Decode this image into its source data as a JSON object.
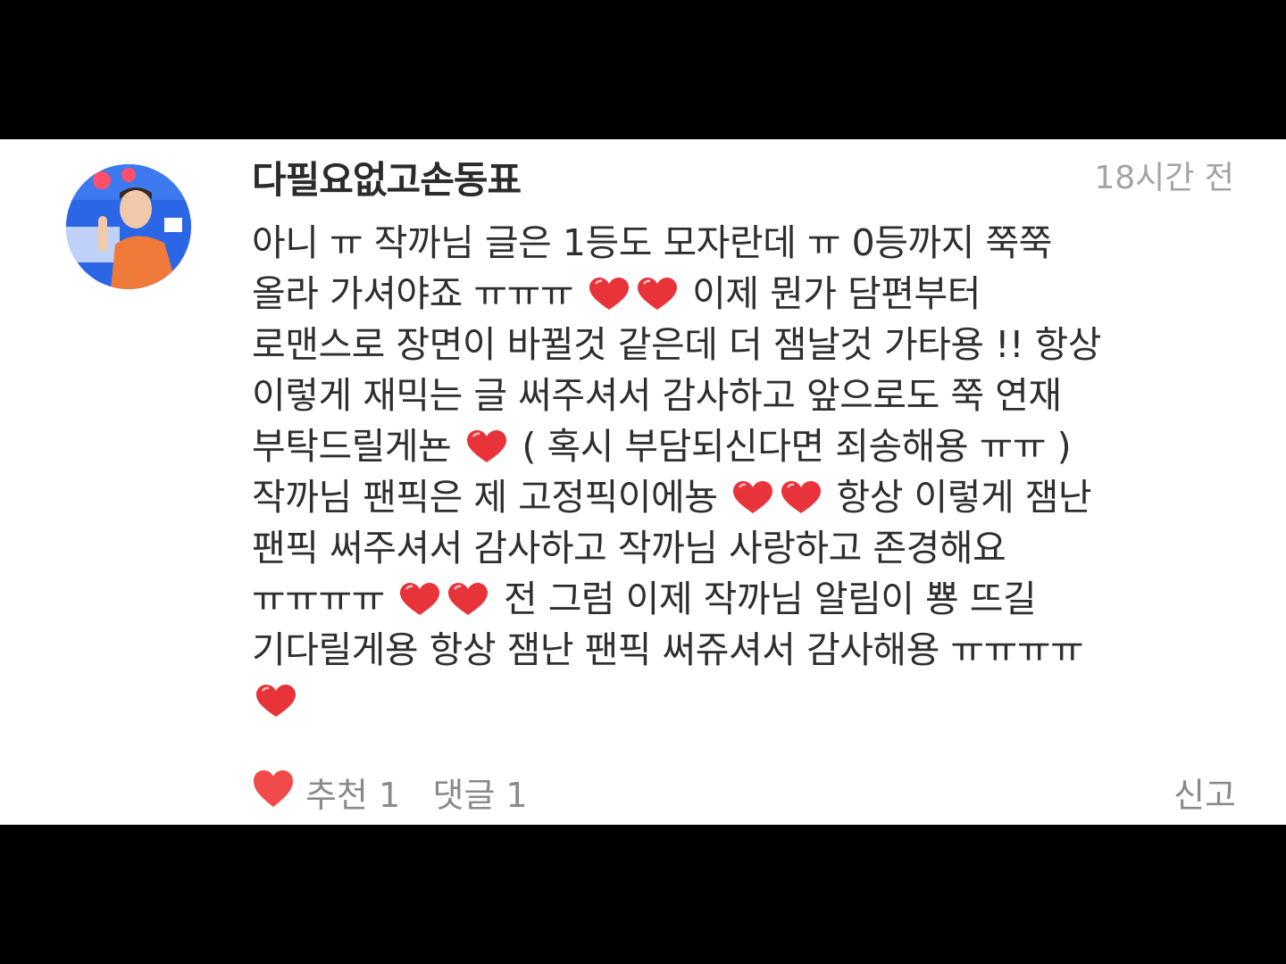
{
  "comment": {
    "username": "다필요없고손동표",
    "timestamp": "18시간 전",
    "lines": [
      [
        {
          "t": "아니 ㅠ 작까님 글은 1등도 모자란데 ㅠ 0등까지 쭉쭉"
        }
      ],
      [
        {
          "t": "올라 가셔야죠 ㅠㅠㅠ "
        },
        {
          "h": 2
        },
        {
          "t": " 이제 뭔가 담편부터"
        }
      ],
      [
        {
          "t": "로맨스로 장면이 바뀔것 같은데 더 잼날것 가타용 !! 항상"
        }
      ],
      [
        {
          "t": "이렇게 재믹는 글 써주셔서 감사하고 앞으로도 쭉 연재"
        }
      ],
      [
        {
          "t": "부탁드릴게뇬 "
        },
        {
          "h": 1
        },
        {
          "t": " ( 혹시 부담되신다면 죄송해용 ㅠㅠ )"
        }
      ],
      [
        {
          "t": "작까님 팬픽은 제 고정픽이에뇽 "
        },
        {
          "h": 2
        },
        {
          "t": " 항상 이렇게 잼난"
        }
      ],
      [
        {
          "t": "팬픽 써주셔서 감사하고 작까님 사랑하고 존경해요"
        }
      ],
      [
        {
          "t": "ㅠㅠㅠㅠ "
        },
        {
          "h": 2
        },
        {
          "t": " 전 그럼 이제 작까님 알림이 뿅 뜨길"
        }
      ],
      [
        {
          "t": "기다릴게용 항상 잼난 팬픽 써쥬셔서 감사해용 ㅠㅠㅠㅠ"
        }
      ],
      [
        {
          "h": 1
        }
      ]
    ],
    "heart_color": "#e8333a",
    "footer": {
      "recommend_label": "추천",
      "recommend_count": "1",
      "reply_label": "댓글",
      "reply_count": "1",
      "report_label": "신고",
      "like_color": "#f04a4a"
    }
  }
}
